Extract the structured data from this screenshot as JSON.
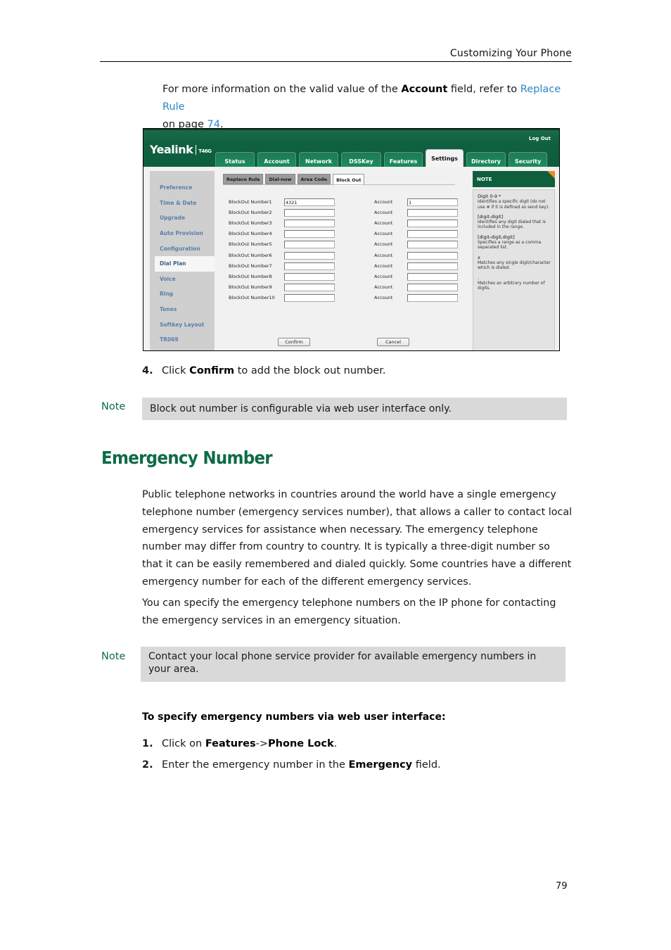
{
  "header": {
    "running_title": "Customizing Your Phone"
  },
  "intro": {
    "text_before": "For more information on the valid value of the ",
    "bold_field": "Account",
    "text_middle": " field, refer to ",
    "link_text": "Replace Rule",
    "text_page_prefix": "on page ",
    "page_link": "74",
    "text_end": "."
  },
  "screenshot": {
    "logo": "Yealink",
    "model": "T46G",
    "logout": "Log Out",
    "top_tabs": [
      {
        "label": "Status",
        "active": false
      },
      {
        "label": "Account",
        "active": false
      },
      {
        "label": "Network",
        "active": false
      },
      {
        "label": "DSSKey",
        "active": false
      },
      {
        "label": "Features",
        "active": false
      },
      {
        "label": "Settings",
        "active": true
      },
      {
        "label": "Directory",
        "active": false
      },
      {
        "label": "Security",
        "active": false
      }
    ],
    "left_nav": [
      {
        "label": "Preference",
        "active": false
      },
      {
        "label": "Time & Date",
        "active": false
      },
      {
        "label": "Upgrade",
        "active": false
      },
      {
        "label": "Auto Provision",
        "active": false
      },
      {
        "label": "Configuration",
        "active": false
      },
      {
        "label": "Dial Plan",
        "active": true
      },
      {
        "label": "Voice",
        "active": false
      },
      {
        "label": "Ring",
        "active": false
      },
      {
        "label": "Tones",
        "active": false
      },
      {
        "label": "Softkey Layout",
        "active": false
      },
      {
        "label": "TR069",
        "active": false
      }
    ],
    "sub_tabs": [
      {
        "label": "Replace Rule",
        "active": false
      },
      {
        "label": "Dial-now",
        "active": false
      },
      {
        "label": "Area Code",
        "active": false
      },
      {
        "label": "Block Out",
        "active": true
      }
    ],
    "rows": [
      {
        "label": "BlockOut Number1",
        "value": "4321",
        "account_label": "Account",
        "account_value": "1"
      },
      {
        "label": "BlockOut Number2",
        "value": "",
        "account_label": "Account",
        "account_value": ""
      },
      {
        "label": "BlockOut Number3",
        "value": "",
        "account_label": "Account",
        "account_value": ""
      },
      {
        "label": "BlockOut Number4",
        "value": "",
        "account_label": "Account",
        "account_value": ""
      },
      {
        "label": "BlockOut Number5",
        "value": "",
        "account_label": "Account",
        "account_value": ""
      },
      {
        "label": "BlockOut Number6",
        "value": "",
        "account_label": "Account",
        "account_value": ""
      },
      {
        "label": "BlockOut Number7",
        "value": "",
        "account_label": "Account",
        "account_value": ""
      },
      {
        "label": "BlockOut Number8",
        "value": "",
        "account_label": "Account",
        "account_value": ""
      },
      {
        "label": "BlockOut Number9",
        "value": "",
        "account_label": "Account",
        "account_value": ""
      },
      {
        "label": "BlockOut Number10",
        "value": "",
        "account_label": "Account",
        "account_value": ""
      }
    ],
    "confirm_label": "Confirm",
    "cancel_label": "Cancel",
    "note": {
      "title": "NOTE",
      "items": [
        {
          "term": "Digit 0-9 *",
          "desc": "Identifies a specific digit (do not use # if it is defined as send key)."
        },
        {
          "term": "[digit-digit]",
          "desc": "Identifies any digit dialed that is included in the range."
        },
        {
          "term": "[digit-digit,digit]",
          "desc": "Specifies a range as a comma separated list."
        },
        {
          "term": "x",
          "desc": "Matches any single digit/character which is dialed."
        },
        {
          "term": ".",
          "desc": "Matches an arbitrary number of digits."
        }
      ]
    }
  },
  "step4": {
    "num": "4.",
    "text_before": "Click ",
    "bold": "Confirm",
    "text_after": " to add the block out number."
  },
  "note1": {
    "label": "Note",
    "text": "Block out number is configurable via web user interface only."
  },
  "section": {
    "title": "Emergency Number",
    "paragraph1": "Public telephone networks in countries around the world have a single emergency telephone number (emergency services number), that allows a caller to contact local emergency services for assistance when necessary. The emergency telephone number may differ from country to country. It is typically a three-digit number so that it can be easily remembered and dialed quickly. Some countries have a different emergency number for each of the different emergency services.",
    "paragraph2": "You can specify the emergency telephone numbers on the IP phone for contacting the emergency services in an emergency situation."
  },
  "note2": {
    "label": "Note",
    "text": "Contact your local phone service provider for available emergency numbers in your area."
  },
  "procedure": {
    "title": "To specify emergency numbers via web user interface:",
    "steps": [
      {
        "num": "1.",
        "text_before": "Click on ",
        "bold": "Features",
        "text_middle": "->",
        "bold2": "Phone Lock",
        "text_after": "."
      },
      {
        "num": "2.",
        "text_before": "Enter the emergency number in the ",
        "bold": "Emergency",
        "text_after": " field."
      }
    ]
  },
  "footer": {
    "page_number": "79"
  }
}
